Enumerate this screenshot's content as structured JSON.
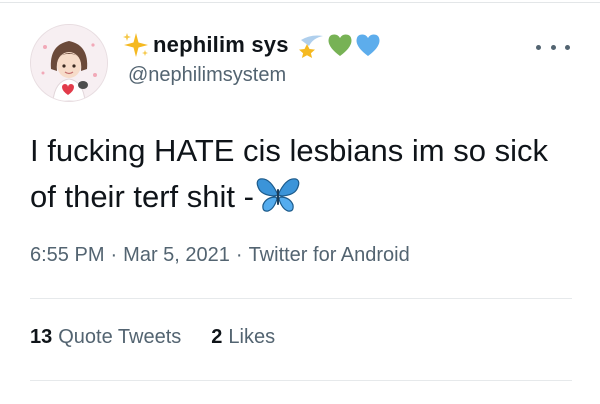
{
  "tweet": {
    "author": {
      "display_name": "nephilim sys",
      "handle": "@nephilimsystem",
      "name_emojis": [
        "sparkles",
        "shooting-star",
        "green-heart",
        "blue-heart"
      ]
    },
    "text": "I fucking HATE cis lesbians im so sick of their terf shit -",
    "trailing_emoji": "butterfly",
    "time": "6:55 PM",
    "date": "Mar 5, 2021",
    "source": "Twitter for Android",
    "separator": "·",
    "stats": {
      "quote_tweets_count": "13",
      "quote_tweets_label": "Quote Tweets",
      "likes_count": "2",
      "likes_label": "Likes"
    }
  },
  "colors": {
    "text": "#0f1419",
    "secondary": "#536471",
    "divider": "#e6e9eb"
  }
}
